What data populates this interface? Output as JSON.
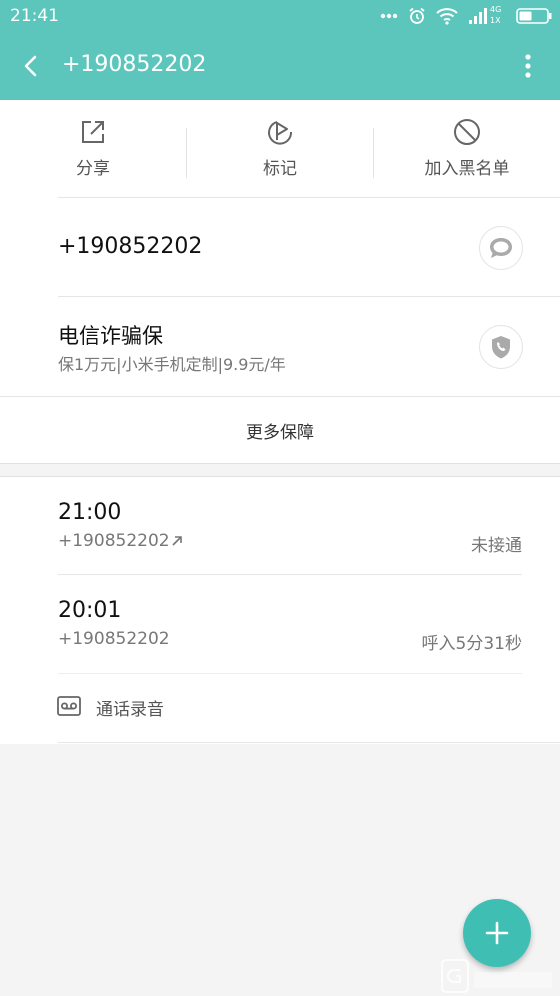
{
  "status_bar": {
    "time": "21:41",
    "network_top": "4G",
    "network_bottom": "1X"
  },
  "header": {
    "title": "+190852202"
  },
  "actions": [
    {
      "label": "分享",
      "icon": "share-icon"
    },
    {
      "label": "标记",
      "icon": "flag-icon"
    },
    {
      "label": "加入黑名单",
      "icon": "block-icon"
    }
  ],
  "contact": {
    "phone": "+190852202",
    "message_icon": "message-icon"
  },
  "insurance": {
    "title": "电信诈骗保",
    "subtitle": "保1万元|小米手机定制|9.9元/年",
    "icon": "shield-phone-icon",
    "more_label": "更多保障"
  },
  "calls": [
    {
      "time": "21:00",
      "number": "+190852202",
      "direction_icon": "outgoing-arrow-icon",
      "status": "未接通"
    },
    {
      "time": "20:01",
      "number": "+190852202",
      "status": "呼入5分31秒"
    }
  ],
  "recording": {
    "label": "通话录音",
    "icon": "recording-icon"
  },
  "fab": {
    "icon": "plus-icon"
  },
  "colors": {
    "accent": "#5cc6bd",
    "fab": "#3fbfb3",
    "background": "#f4f4f4"
  }
}
